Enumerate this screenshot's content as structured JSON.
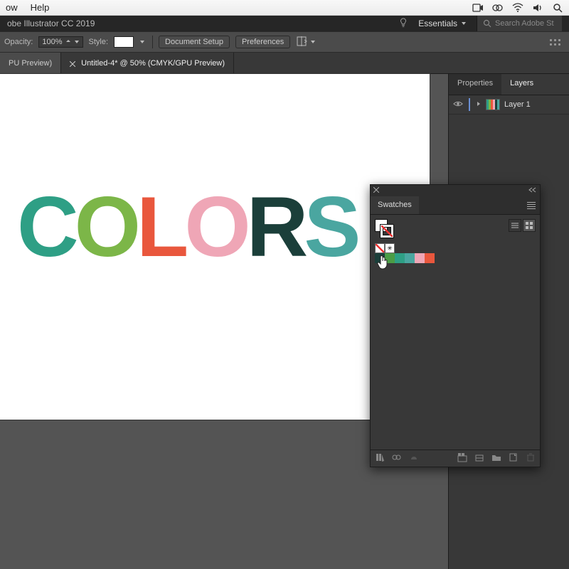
{
  "mac_menu": {
    "items": [
      "ow",
      "Help"
    ]
  },
  "app": {
    "title": "obe Illustrator CC 2019",
    "workspace": "Essentials",
    "search_placeholder": "Search Adobe St"
  },
  "control_bar": {
    "opacity_label": "Opacity:",
    "opacity_value": "100%",
    "style_label": "Style:",
    "doc_setup": "Document Setup",
    "preferences": "Preferences"
  },
  "tabs": [
    {
      "label": "PU Preview)",
      "active": false
    },
    {
      "label": "Untitled-4* @ 50% (CMYK/GPU Preview)",
      "active": true
    }
  ],
  "canvas": {
    "letters": [
      {
        "char": "C",
        "color": "#2e9f85"
      },
      {
        "char": "O",
        "color": "#7cb648"
      },
      {
        "char": "L",
        "color": "#e9573d"
      },
      {
        "char": "O",
        "color": "#efa6b6"
      },
      {
        "char": "R",
        "color": "#1b3f3a"
      },
      {
        "char": "S",
        "color": "#4aa6a0"
      }
    ]
  },
  "right_dock": {
    "tabs": [
      "Properties",
      "Layers"
    ],
    "active_tab": 1,
    "layer": {
      "name": "Layer 1"
    }
  },
  "swatches_panel": {
    "title": "Swatches",
    "row1": [
      "none",
      "reg"
    ],
    "row2_colors": [
      "#1b3f3a",
      "#4a9d46",
      "#2e9f85",
      "#4aa6a0",
      "#efa6b6",
      "#e9573d"
    ]
  }
}
